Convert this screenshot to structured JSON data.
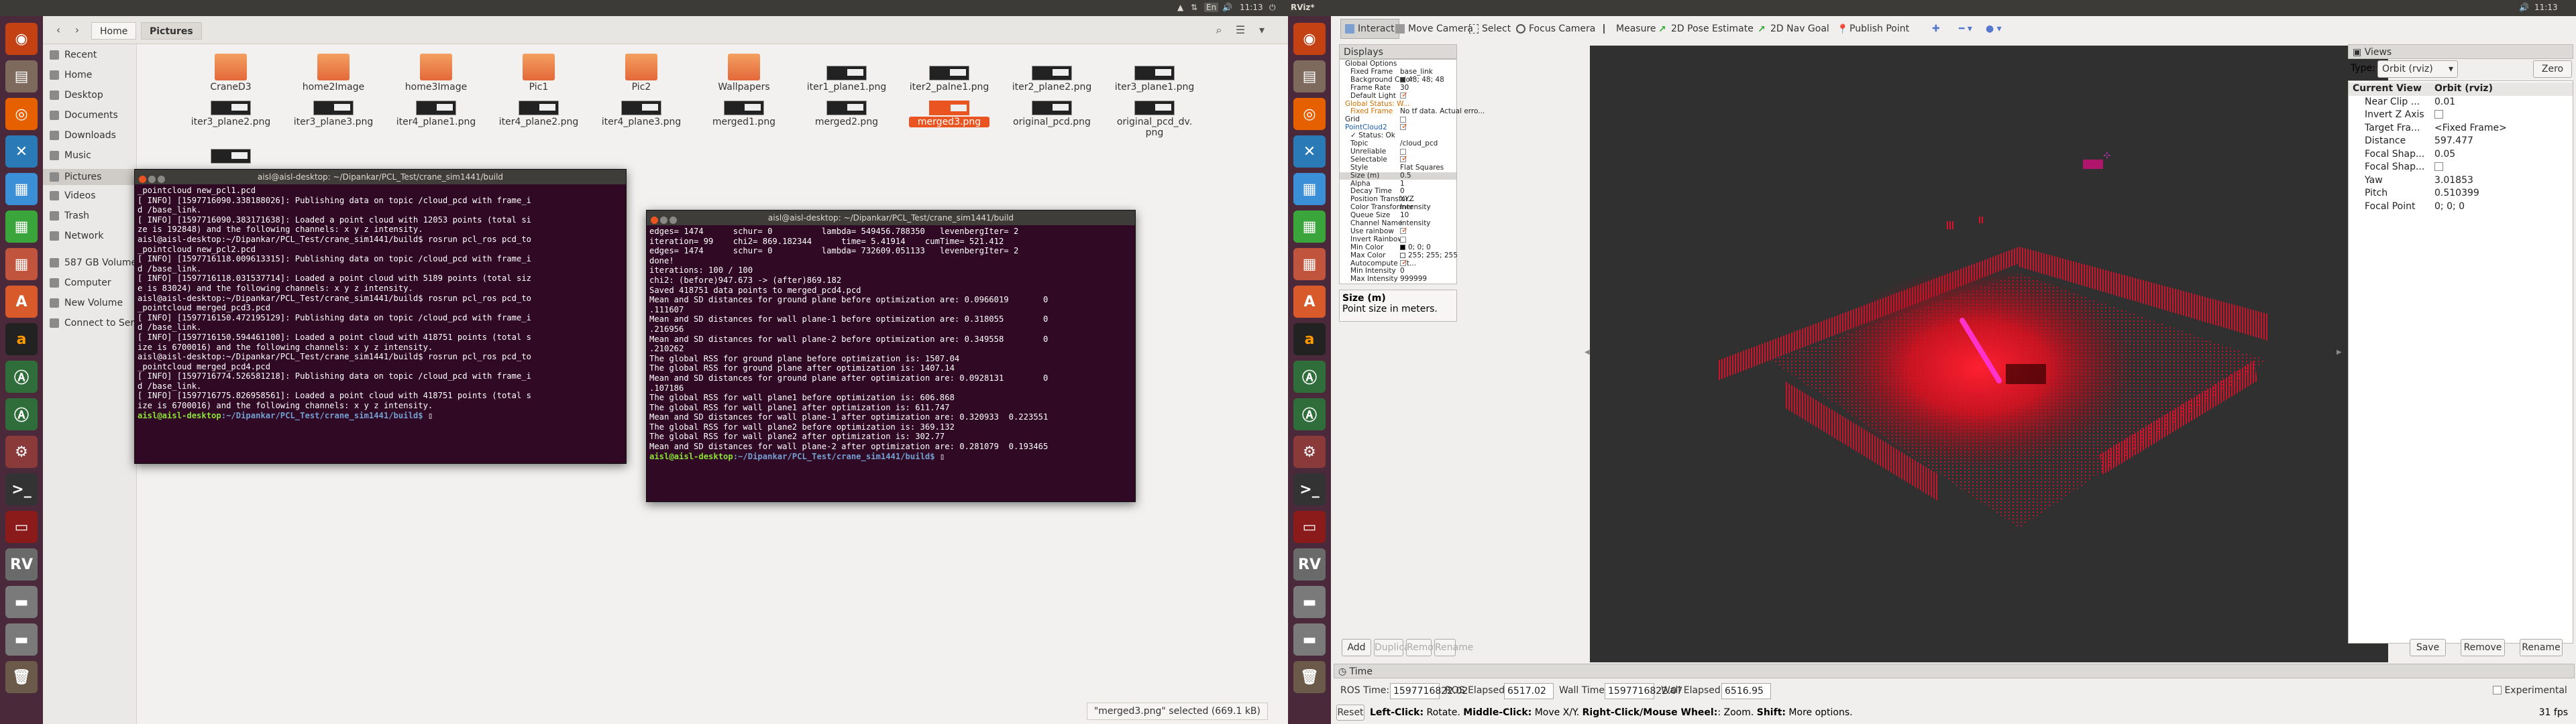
{
  "left_desktop": {
    "topbar": {
      "indicators": [
        "▲",
        "⇅",
        "En",
        "🔊"
      ],
      "time": "11:13",
      "power": "⏻"
    },
    "files": {
      "breadcrumb": [
        "Home",
        "Pictures"
      ],
      "sidebar": [
        "Recent",
        "Home",
        "Desktop",
        "Documents",
        "Downloads",
        "Music",
        "Pictures",
        "Videos",
        "Trash",
        "Network",
        "587 GB Volume",
        "Computer",
        "New Volume",
        "Connect to Server"
      ],
      "selected_sidebar": "Pictures",
      "row1": [
        {
          "name": "CraneD3",
          "kind": "folder"
        },
        {
          "name": "home2Image",
          "kind": "folder"
        },
        {
          "name": "home3Image",
          "kind": "folder"
        },
        {
          "name": "Pic1",
          "kind": "folder"
        },
        {
          "name": "Pic2",
          "kind": "folder"
        },
        {
          "name": "Wallpapers",
          "kind": "folder"
        },
        {
          "name": "iter1_plane1.png",
          "kind": "image"
        },
        {
          "name": "iter2_palne1.png",
          "kind": "image"
        },
        {
          "name": "iter2_plane2.png",
          "kind": "image"
        },
        {
          "name": "iter3_plane1.png",
          "kind": "image"
        }
      ],
      "row2": [
        {
          "name": "iter3_plane2.png"
        },
        {
          "name": "iter3_plane3.png"
        },
        {
          "name": "iter4_plane1.png"
        },
        {
          "name": "iter4_plane2.png"
        },
        {
          "name": "iter4_plane3.png"
        },
        {
          "name": "merged1.png"
        },
        {
          "name": "merged2.png"
        },
        {
          "name": "merged3.png",
          "selected": true
        },
        {
          "name": "original_pcd.png"
        },
        {
          "name": "original_pcd_dv.\npng"
        }
      ],
      "status": "\"merged3.png\" selected  (669.1 kB)"
    },
    "term1": {
      "title": "aisl@aisl-desktop: ~/Dipankar/PCL_Test/crane_sim1441/build",
      "lines": [
        "_pointcloud new_pcl1.pcd",
        "[ INFO] [1597716090.338188026]: Publishing data on topic /cloud_pcd with frame_i",
        "d /base_link.",
        "[ INFO] [1597716090.383171638]: Loaded a point cloud with 12053 points (total si",
        "ze is 192848) and the following channels: x y z intensity.",
        "aisl@aisl-desktop:~/Dipankar/PCL_Test/crane_sim1441/build$ rosrun pcl_ros pcd_to",
        "_pointcloud new_pcl2.pcd",
        "[ INFO] [1597716118.009613315]: Publishing data on topic /cloud_pcd with frame_i",
        "d /base_link.",
        "[ INFO] [1597716118.031537714]: Loaded a point cloud with 5189 points (total siz",
        "e is 83024) and the following channels: x y z intensity.",
        "aisl@aisl-desktop:~/Dipankar/PCL_Test/crane_sim1441/build$ rosrun pcl_ros pcd_to",
        "_pointcloud merged_pcd3.pcd",
        "[ INFO] [1597716150.472195129]: Publishing data on topic /cloud_pcd with frame_i",
        "d /base_link.",
        "[ INFO] [1597716150.594461100]: Loaded a point cloud with 418751 points (total s",
        "ize is 6700016) and the following channels: x y z intensity.",
        "aisl@aisl-desktop:~/Dipankar/PCL_Test/crane_sim1441/build$ rosrun pcl_ros pcd_to",
        "_pointcloud merged_pcd4.pcd",
        "[ INFO] [1597716774.526581218]: Publishing data on topic /cloud_pcd with frame_i",
        "d /base_link.",
        "[ INFO] [1597716775.826958561]: Loaded a point cloud with 418751 points (total s",
        "ize is 6700016) and the following channels: x y z intensity."
      ],
      "prompt_user": "aisl@aisl-desktop",
      "prompt_path": ":~/Dipankar/PCL_Test/crane_sim1441/build$"
    },
    "term2": {
      "title": "aisl@aisl-desktop: ~/Dipankar/PCL_Test/crane_sim1441/build",
      "lines": [
        "edges= 1474      schur= 0          lambda= 549456.788350   levenbergIter= 2",
        "iteration= 99    chi2= 869.182344      time= 5.41914    cumTime= 521.412",
        "edges= 1474      schur= 0          lambda= 732609.051133   levenbergIter= 2",
        "done!",
        "iterations: 100 / 100",
        "chi2: (before)947.673 -> (after)869.182",
        "Saved 418751 data points to merged_pcd4.pcd",
        "Mean and SD distances for ground plane before optimization are: 0.0966019       0",
        ".111607",
        "Mean and SD distances for wall plane-1 before optimization are: 0.318055        0",
        ".216956",
        "Mean and SD distances for wall plane-2 before optimization are: 0.349558        0",
        ".210262",
        "The global RSS for ground plane before optimization is: 1507.04",
        "The global RSS for ground plane after optimization is: 1407.14",
        "Mean and SD distances for ground plane after optimization are: 0.0928131        0",
        ".107186",
        "The global RSS for wall plane1 before optimization is: 606.868",
        "The global RSS for wall plane1 after optimization is: 611.747",
        "Mean and SD distances for wall plane-1 after optimization are: 0.320933  0.223551",
        "The global RSS for wall plane2 before optimization is: 369.132",
        "The global RSS for wall plane2 after optimization is: 302.77",
        "Mean and SD distances for wall plane-2 after optimization are: 0.281079  0.193465"
      ],
      "prompt_user": "aisl@aisl-desktop",
      "prompt_path": ":~/Dipankar/PCL_Test/crane_sim1441/build$"
    }
  },
  "rviz": {
    "topbar": {
      "app": "RViz*",
      "time": "11:13"
    },
    "tools": [
      "Interact",
      "Move Camera",
      "Select",
      "Focus Camera",
      "Measure",
      "2D Pose Estimate",
      "2D Nav Goal",
      "Publish Point"
    ],
    "displays_title": "Displays",
    "rows": [
      {
        "label": "Global Options",
        "value": "",
        "indent": 1,
        "kind": "group"
      },
      {
        "label": "Fixed Frame",
        "value": "base_link",
        "indent": 2
      },
      {
        "label": "Background Color",
        "value": "48; 48; 48",
        "indent": 2,
        "swatch": "#303030"
      },
      {
        "label": "Frame Rate",
        "value": "30",
        "indent": 2
      },
      {
        "label": "Default Light",
        "value": "",
        "indent": 2,
        "check": true
      },
      {
        "label": "Global Status: W...",
        "value": "",
        "indent": 1,
        "kind": "warn"
      },
      {
        "label": "Fixed Frame",
        "value": "No tf data.  Actual erro...",
        "indent": 2,
        "kind": "warnsub"
      },
      {
        "label": "Grid",
        "value": "",
        "indent": 1,
        "check": false
      },
      {
        "label": "PointCloud2",
        "value": "",
        "indent": 1,
        "check": true,
        "kind": "pc"
      },
      {
        "label": "✓ Status: Ok",
        "value": "",
        "indent": 2
      },
      {
        "label": "Topic",
        "value": "/cloud_pcd",
        "indent": 2
      },
      {
        "label": "Unreliable",
        "value": "",
        "indent": 2,
        "check": false
      },
      {
        "label": "Selectable",
        "value": "",
        "indent": 2,
        "check": true
      },
      {
        "label": "Style",
        "value": "Flat Squares",
        "indent": 2
      },
      {
        "label": "Size (m)",
        "value": "0.5",
        "indent": 2,
        "hl": true
      },
      {
        "label": "Alpha",
        "value": "1",
        "indent": 2
      },
      {
        "label": "Decay Time",
        "value": "0",
        "indent": 2
      },
      {
        "label": "Position Transfor...",
        "value": "XYZ",
        "indent": 2
      },
      {
        "label": "Color Transformer",
        "value": "Intensity",
        "indent": 2
      },
      {
        "label": "Queue Size",
        "value": "10",
        "indent": 2
      },
      {
        "label": "Channel Name",
        "value": "intensity",
        "indent": 2
      },
      {
        "label": "Use rainbow",
        "value": "",
        "indent": 2,
        "check": true
      },
      {
        "label": "Invert Rainbow",
        "value": "",
        "indent": 2,
        "check": false
      },
      {
        "label": "Min Color",
        "value": "0; 0; 0",
        "indent": 2,
        "swatch": "#000000"
      },
      {
        "label": "Max Color",
        "value": "255; 255; 255",
        "indent": 2,
        "swatch": "#ffffff"
      },
      {
        "label": "Autocompute Int...",
        "value": "",
        "indent": 2,
        "check": true
      },
      {
        "label": "Min Intensity",
        "value": "0",
        "indent": 2
      },
      {
        "label": "Max Intensity",
        "value": "999999",
        "indent": 2
      }
    ],
    "desc_title": "Size (m)",
    "desc_text": "Point size in meters.",
    "display_buttons": [
      "Add",
      "Duplicate",
      "Remove",
      "Rename"
    ],
    "views": {
      "title": "Views",
      "type_label": "Type:",
      "type_value": "Orbit (rviz)",
      "zero": "Zero",
      "rows": [
        {
          "label": "Current View",
          "value": "Orbit (rviz)",
          "head": true
        },
        {
          "label": "Near Clip ...",
          "value": "0.01"
        },
        {
          "label": "Invert Z Axis",
          "value": "",
          "check": false
        },
        {
          "label": "Target Fra...",
          "value": "<Fixed Frame>"
        },
        {
          "label": "Distance",
          "value": "597.477"
        },
        {
          "label": "Focal Shap...",
          "value": "0.05"
        },
        {
          "label": "Focal Shap...",
          "value": "",
          "check": false
        },
        {
          "label": "Yaw",
          "value": "3.01853"
        },
        {
          "label": "Pitch",
          "value": "0.510399"
        },
        {
          "label": "Focal Point",
          "value": "0; 0; 0"
        }
      ],
      "buttons": [
        "Save",
        "Remove",
        "Rename"
      ]
    },
    "time": {
      "title": "Time",
      "ros_time_label": "ROS Time:",
      "ros_time": "1597716822.02",
      "ros_elapsed_label": "ROS Elapsed:",
      "ros_elapsed": "6517.02",
      "wall_time_label": "Wall Time:",
      "wall_time": "1597716822.07",
      "wall_elapsed_label": "Wall Elapsed:",
      "wall_elapsed": "6516.95",
      "experimental": "Experimental"
    },
    "bottom": {
      "reset": "Reset",
      "hint_b1": "Left-Click:",
      "hint_t1": " Rotate. ",
      "hint_b2": "Middle-Click:",
      "hint_t2": " Move X/Y. ",
      "hint_b3": "Right-Click/Mouse Wheel:",
      "hint_t3": ": Zoom. ",
      "hint_b4": "Shift:",
      "hint_t4": " More options.",
      "fps": "31 fps"
    }
  }
}
